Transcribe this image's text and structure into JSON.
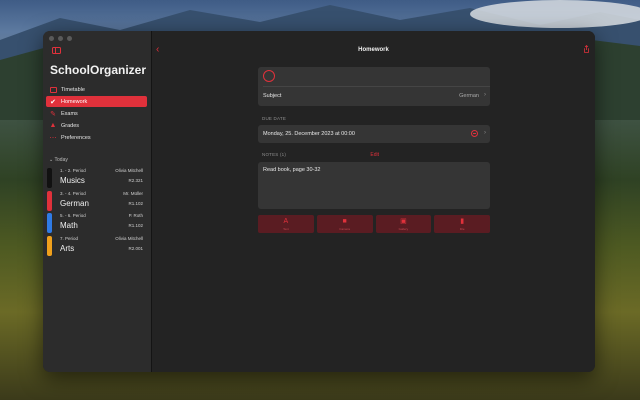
{
  "window": {
    "app_title": "SchoolOrganizer",
    "page_title": "Homework"
  },
  "colors": {
    "accent": "#e0313b",
    "lesson_colors": [
      "#111111",
      "#e0313b",
      "#2f7be6",
      "#f0a01c"
    ]
  },
  "sidebar": {
    "items": [
      {
        "label": "Timetable",
        "icon": "calendar-icon",
        "active": false
      },
      {
        "label": "Homework",
        "icon": "checkmark-icon",
        "active": true
      },
      {
        "label": "Exams",
        "icon": "pencil-icon",
        "active": false
      },
      {
        "label": "Grades",
        "icon": "graduation-cap-icon",
        "active": false
      },
      {
        "label": "Preferences",
        "icon": "sliders-icon",
        "active": false
      }
    ],
    "today_header": "Today",
    "lessons": [
      {
        "period": "1. - 2. Period",
        "teacher": "Olivia Mitchell",
        "subject": "Musics",
        "room": "R2.321"
      },
      {
        "period": "3. - 4. Period",
        "teacher": "Mr. Müller",
        "subject": "German",
        "room": "R1.102"
      },
      {
        "period": "5. - 6. Period",
        "teacher": "P. Roth",
        "subject": "Math",
        "room": "R1.102"
      },
      {
        "period": "7. Period",
        "teacher": "Olivia Mitchell",
        "subject": "Arts",
        "room": "R2.001"
      }
    ]
  },
  "homework": {
    "subject_label": "Subject",
    "subject_value": "German",
    "due_date_label": "DUE DATE",
    "due_date_value": "Monday, 25. December 2023 at 00:00",
    "notes_label": "NOTES (1)",
    "edit_label": "Edit",
    "notes_text": "Read book, page 30-32"
  },
  "actions": [
    {
      "label": "Text",
      "icon": "text-icon"
    },
    {
      "label": "Camera",
      "icon": "camera-icon"
    },
    {
      "label": "Gallery",
      "icon": "gallery-icon"
    },
    {
      "label": "File",
      "icon": "file-icon"
    }
  ]
}
